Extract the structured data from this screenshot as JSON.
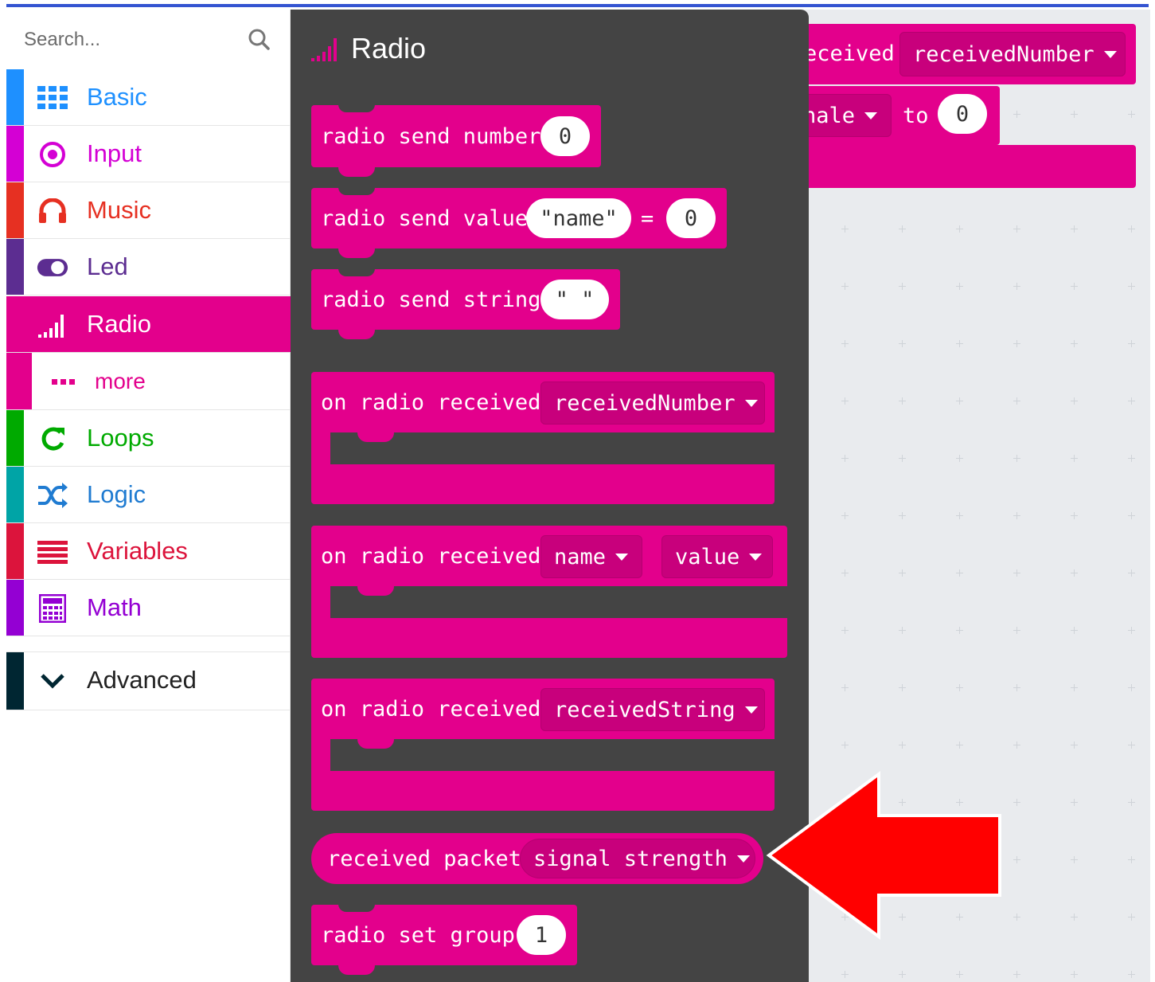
{
  "search": {
    "placeholder": "Search..."
  },
  "categories": [
    {
      "label": "Basic",
      "color": "#1e90ff",
      "icon": "grid-icon"
    },
    {
      "label": "Input",
      "color": "#d400d4",
      "icon": "target-icon"
    },
    {
      "label": "Music",
      "color": "#e63022",
      "icon": "headphones-icon"
    },
    {
      "label": "Led",
      "color": "#5c2d91",
      "icon": "toggle-icon"
    },
    {
      "label": "Radio",
      "color": "#e3008c",
      "icon": "signal-bars-icon"
    },
    {
      "label": "more",
      "color": "#e3008c",
      "icon": "dots-icon"
    },
    {
      "label": "Loops",
      "color": "#00aa00",
      "icon": "refresh-icon"
    },
    {
      "label": "Logic",
      "color": "#00a4a6",
      "icon": "shuffle-icon"
    },
    {
      "label": "Variables",
      "color": "#dc143c",
      "icon": "lines-icon"
    },
    {
      "label": "Math",
      "color": "#9400d3",
      "icon": "calculator-icon"
    },
    {
      "label": "Advanced",
      "color": "#002632",
      "icon": "chevron-down-icon"
    }
  ],
  "flyout": {
    "title": "Radio",
    "blocks": {
      "send_number": {
        "text": "radio send number",
        "value": "0"
      },
      "send_value": {
        "text": "radio send value",
        "name": "\"name\"",
        "equals": "=",
        "value": "0"
      },
      "send_string": {
        "text": "radio send string",
        "value": "\"  \""
      },
      "on_received_number": {
        "text": "on radio received",
        "param": "receivedNumber"
      },
      "on_received_value": {
        "text": "on radio received",
        "param1": "name",
        "param2": "value"
      },
      "on_received_string": {
        "text": "on radio received",
        "param": "receivedString"
      },
      "received_packet": {
        "text": "received packet",
        "option": "signal strength"
      },
      "set_group": {
        "text": "radio set group",
        "value": "1"
      }
    }
  },
  "workspace": {
    "event_text": "eceived",
    "event_param": "receivedNumber",
    "set_var": "nale",
    "to_label": "to",
    "set_value": "0"
  },
  "colors": {
    "radio": "#e3008c",
    "flyout_bg": "#444444",
    "workspace_bg": "#e9ebee",
    "arrow": "#ff0000"
  }
}
